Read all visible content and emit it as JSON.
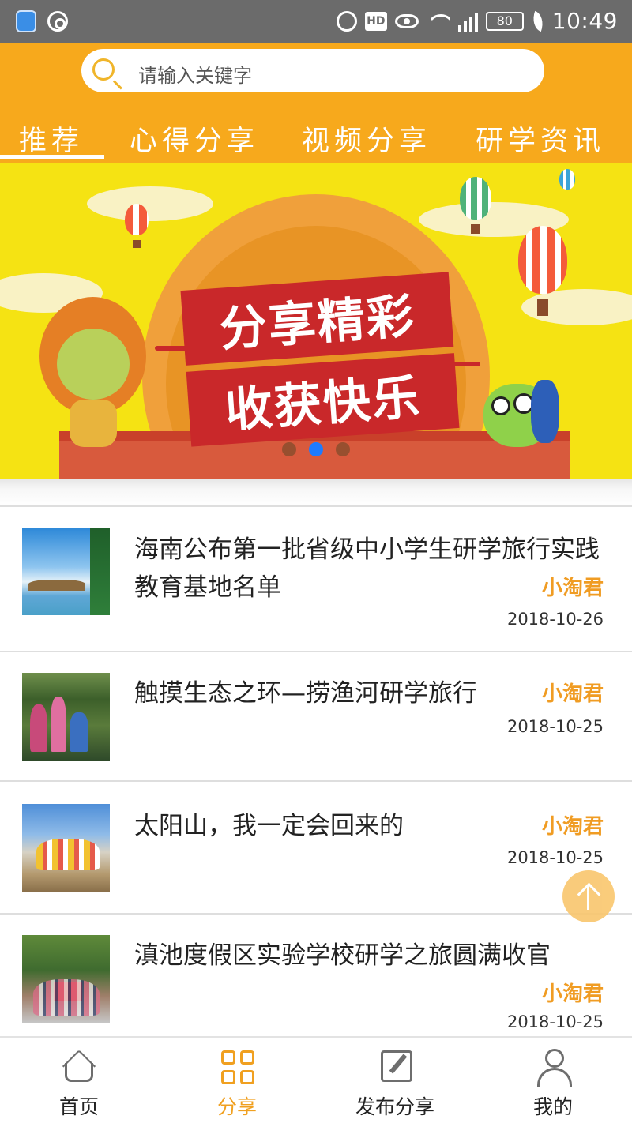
{
  "status_bar": {
    "time": "10:49",
    "battery": "80",
    "hd_badge": "HD",
    "network": "4G"
  },
  "search": {
    "placeholder": "请输入关键字"
  },
  "tabs": [
    {
      "label": "推荐",
      "active": true
    },
    {
      "label": "心得分享",
      "active": false
    },
    {
      "label": "视频分享",
      "active": false
    },
    {
      "label": "研学资讯",
      "active": false
    }
  ],
  "banner": {
    "line1": "分享精彩",
    "line2": "收获快乐",
    "slide_count": 3,
    "active_slide": 2
  },
  "articles": [
    {
      "title": "海南公布第一批省级中小学生研学旅行实践教育基地名单",
      "author": "小淘君",
      "date": "2018-10-26"
    },
    {
      "title": "触摸生态之环—捞渔河研学旅行",
      "author": "小淘君",
      "date": "2018-10-25"
    },
    {
      "title": "太阳山，我一定会回来的",
      "author": "小淘君",
      "date": "2018-10-25"
    },
    {
      "title": "滇池度假区实验学校研学之旅圆满收官",
      "author": "小淘君",
      "date": "2018-10-25"
    }
  ],
  "bottom_nav": [
    {
      "label": "首页",
      "icon": "home-icon",
      "active": false
    },
    {
      "label": "分享",
      "icon": "grid-icon",
      "active": true
    },
    {
      "label": "发布分享",
      "icon": "edit-icon",
      "active": false
    },
    {
      "label": "我的",
      "icon": "user-icon",
      "active": false
    }
  ],
  "colors": {
    "accent": "#f7a91c",
    "author": "#f09c23",
    "active_nav": "#f0a020"
  }
}
